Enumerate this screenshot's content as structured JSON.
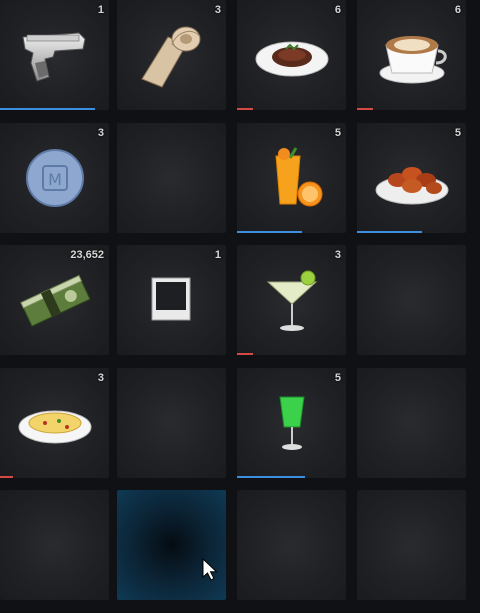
{
  "inventory": {
    "slots": [
      {
        "item": "desert-eagle-pistol",
        "count": "1",
        "bar": {
          "color": "#3e8ee0",
          "fill": 0.87
        }
      },
      {
        "item": "bandage-roll",
        "count": "3"
      },
      {
        "item": "steak-plate",
        "count": "6",
        "bar": {
          "color": "#d44a42",
          "fill": 0.15
        }
      },
      {
        "item": "cappuccino-cup",
        "count": "6",
        "bar": {
          "color": "#d44a42",
          "fill": 0.15
        }
      },
      {
        "item": "m-pill",
        "count": "3"
      },
      {
        "item": "empty",
        "count": ""
      },
      {
        "item": "orange-juice",
        "count": "5",
        "bar": {
          "color": "#3e8ee0",
          "fill": 0.6
        }
      },
      {
        "item": "chicken-wings",
        "count": "5",
        "bar": {
          "color": "#3e8ee0",
          "fill": 0.6
        }
      },
      {
        "item": "cash-stack",
        "count": "23,652"
      },
      {
        "item": "polaroid-photo",
        "count": "1"
      },
      {
        "item": "margarita-cocktail",
        "count": "3",
        "bar": {
          "color": "#d44a42",
          "fill": 0.15
        }
      },
      {
        "item": "empty",
        "count": ""
      },
      {
        "item": "omelette-plate",
        "count": "3",
        "bar": {
          "color": "#d44a42",
          "fill": 0.12
        }
      },
      {
        "item": "empty",
        "count": ""
      },
      {
        "item": "green-cocktail",
        "count": "5",
        "bar": {
          "color": "#3e8ee0",
          "fill": 0.62
        }
      },
      {
        "item": "empty",
        "count": ""
      },
      {
        "item": "empty",
        "count": ""
      },
      {
        "item": "empty-highlighted",
        "count": ""
      },
      {
        "item": "empty",
        "count": ""
      },
      {
        "item": "empty",
        "count": ""
      }
    ]
  },
  "cursor": {
    "icon": "arrow-cursor-icon"
  }
}
